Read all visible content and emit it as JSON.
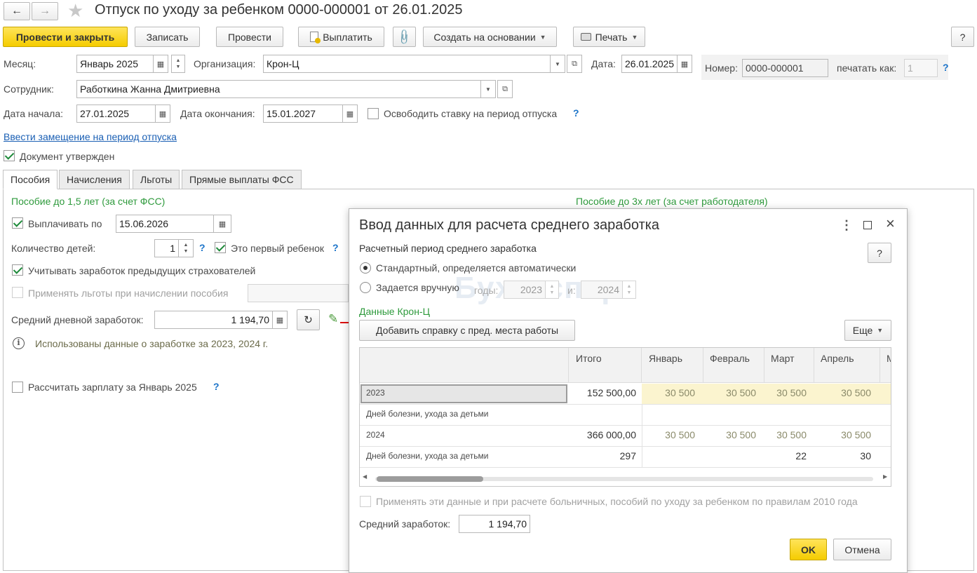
{
  "window": {
    "title": "Отпуск по уходу за ребенком 0000-000001 от 26.01.2025"
  },
  "toolbar": {
    "post_close": "Провести и закрыть",
    "save": "Записать",
    "post": "Провести",
    "pay": "Выплатить",
    "create_based": "Создать на основании",
    "print": "Печать",
    "help": "?"
  },
  "header": {
    "month_label": "Месяц:",
    "month_value": "Январь 2025",
    "org_label": "Организация:",
    "org_value": "Крон-Ц",
    "date_label": "Дата:",
    "date_value": "26.01.2025",
    "number_label": "Номер:",
    "number_value": "0000-000001",
    "print_as_label": "печатать как:",
    "print_as_value": "1",
    "employee_label": "Сотрудник:",
    "employee_value": "Работкина Жанна Дмитриевна",
    "start_label": "Дата начала:",
    "start_value": "27.01.2025",
    "end_label": "Дата окончания:",
    "end_value": "15.01.2027",
    "free_rate_label": "Освободить ставку на период отпуска",
    "replacement_link": "Ввести замещение на период отпуска",
    "approved_label": "Документ утвержден"
  },
  "tabs": [
    "Пособия",
    "Начисления",
    "Льготы",
    "Прямые выплаты ФСС"
  ],
  "benefits": {
    "section1_title": "Пособие до 1,5 лет (за счет ФСС)",
    "section2_title": "Пособие до 3х лет (за счет работодателя)",
    "pay_until_label": "Выплачивать по",
    "pay_until_value": "15.06.2026",
    "children_label": "Количество детей:",
    "children_value": "1",
    "first_child_label": "Это первый ребенок",
    "prev_insurers_label": "Учитывать заработок предыдущих страхователей",
    "apply_benefits_label": "Применять льготы при начислении пособия",
    "avg_daily_label": "Средний дневной заработок:",
    "avg_daily_value": "1 194,70",
    "info_text": "Использованы данные о заработке за  2023,  2024 г.",
    "calc_salary_label": "Рассчитать зарплату за Январь 2025"
  },
  "dialog": {
    "title": "Ввод данных для расчета среднего заработка",
    "period_title": "Расчетный период среднего заработка",
    "radio_standard": "Стандартный, определяется автоматически",
    "radio_manual": "Задается вручную",
    "years_label": "годы:",
    "year_from": "2023",
    "and_label": "и:",
    "year_to": "2024",
    "watermark": "Бухэксперт",
    "data_title": "Данные Крон-Ц",
    "add_cert_btn": "Добавить справку с пред. места работы",
    "more_btn": "Еще",
    "help": "?",
    "columns": [
      "",
      "Итого",
      "Январь",
      "Февраль",
      "Март",
      "Апрель",
      "М"
    ],
    "rows": [
      {
        "label": "2023",
        "total": "152 500,00",
        "months": [
          "30 500",
          "30 500",
          "30 500",
          "30 500"
        ]
      },
      {
        "label": "Дней болезни, ухода за детьми",
        "total": "",
        "months": [
          "",
          "",
          "",
          ""
        ]
      },
      {
        "label": "2024",
        "total": "366 000,00",
        "months": [
          "30 500",
          "30 500",
          "30 500",
          "30 500"
        ]
      },
      {
        "label": "Дней болезни, ухода за детьми",
        "total": "297",
        "months": [
          "",
          "",
          "22",
          "30"
        ]
      }
    ],
    "apply_2010_label": "Применять эти данные и при расчете больничных, пособий по уходу за ребенком по правилам 2010 года",
    "avg_label": "Средний заработок:",
    "avg_value": "1 194,70",
    "ok": "OK",
    "cancel": "Отмена"
  },
  "colors": {
    "primary_button": "#f5cc00",
    "section_green": "#2e9a3c",
    "link_blue": "#1a5fb4",
    "highlight_yellow": "#fbf4cf"
  }
}
